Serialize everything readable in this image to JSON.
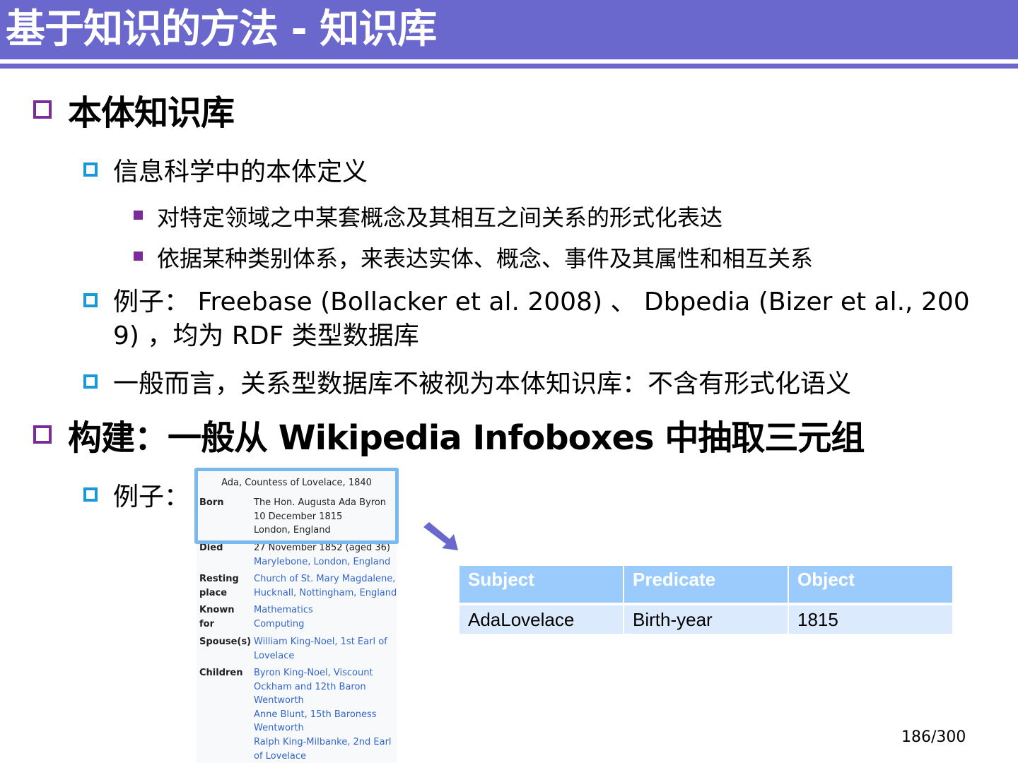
{
  "slide": {
    "title": "基于知识的方法 - 知识库",
    "page_number": "186/300"
  },
  "outline": {
    "section1": "本体知识库",
    "sub1": "信息科学中的本体定义",
    "sub1_item1": "对特定领域之中某套概念及其相互之间关系的形式化表达",
    "sub1_item2": "依据某种类别体系，来表达实体、概念、事件及其属性和相互关系",
    "sub2_line1": "例子： Freebase (Bollacker et al. 2008) 、 Dbpedia (Bizer et al., 200",
    "sub2_line2": "9) ，均为 RDF 类型数据库",
    "sub3": "一般而言，关系型数据库不被视为本体知识库：不含有形式化语义",
    "section2": "构建：一般从 Wikipedia Infoboxes 中抽取三元组",
    "example_label": "例子："
  },
  "infobox": {
    "caption": "Ada, Countess of Lovelace, 1840",
    "rows": [
      {
        "label": "Born",
        "lines": [
          "The Hon. Augusta Ada Byron",
          "10 December 1815",
          "London, England"
        ]
      },
      {
        "label": "Died",
        "lines": [
          "27 November 1852 (aged 36)",
          "Marylebone, London, England"
        ]
      },
      {
        "label": "Resting place",
        "lines": [
          "Church of St. Mary Magdalene,",
          "Hucknall, Nottingham, England"
        ]
      },
      {
        "label": "Known for",
        "lines": [
          "Mathematics",
          "Computing"
        ]
      },
      {
        "label": "Spouse(s)",
        "lines": [
          "William King-Noel, 1st Earl of",
          "Lovelace"
        ]
      },
      {
        "label": "Children",
        "lines": [
          "Byron King-Noel, Viscount",
          "Ockham and 12th Baron",
          "Wentworth",
          "Anne Blunt, 15th Baroness",
          "Wentworth",
          "Ralph King-Milbanke, 2nd Earl",
          "of Lovelace"
        ]
      }
    ]
  },
  "triple_table": {
    "headers": [
      "Subject",
      "Predicate",
      "Object"
    ],
    "row": [
      "AdaLovelace",
      "Birth-year",
      "1815"
    ]
  },
  "colors": {
    "title_bar": "#6a67cd",
    "bullet_level1": "#7b2c9a",
    "bullet_level2": "#1898d8",
    "table_header": "#9acbfc",
    "table_cell": "#dbeafc",
    "highlight": "#7ab8f0",
    "link": "#3366cc"
  }
}
